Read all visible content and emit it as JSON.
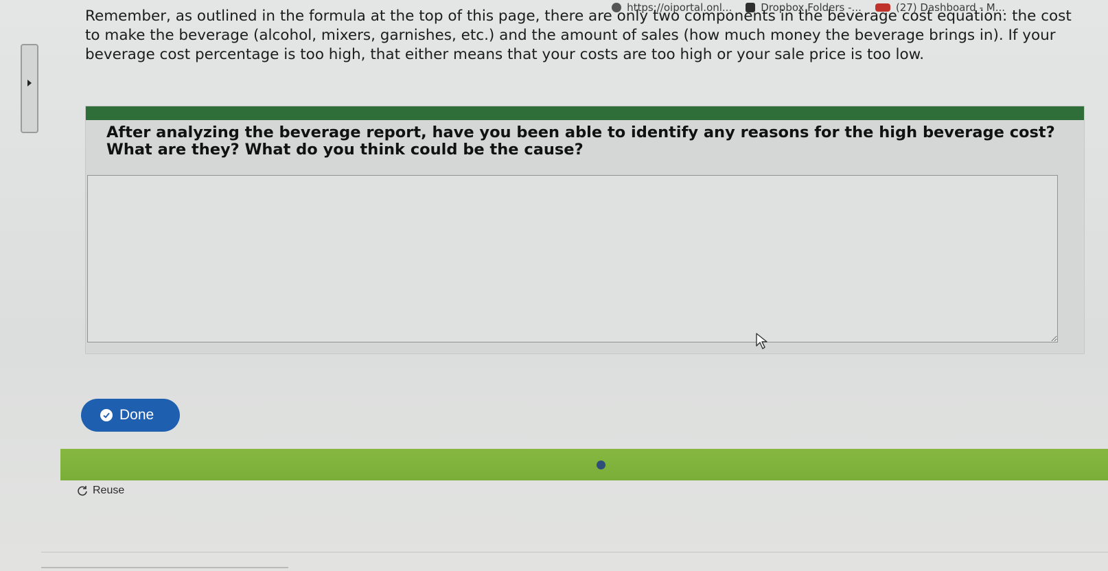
{
  "bookmarks": [
    {
      "label": "https://oiportal.onl...",
      "icon": "globe-icon"
    },
    {
      "label": "Dropbox Folders -...",
      "icon": "dropbox-icon"
    },
    {
      "label": "(27) Dashboard - M...",
      "icon": "dashboard-icon"
    }
  ],
  "intro": {
    "text": "Remember, as outlined in the formula at the top of this page, there are only two components in the beverage cost equation: the cost to make the beverage (alcohol, mixers, garnishes, etc.) and the amount of sales (how much money the beverage brings in). If your beverage cost percentage is too high, that either means that your costs are too high or your sale price is too low."
  },
  "question": {
    "text": "After analyzing the beverage report, have you been able to identify any reasons for the high beverage cost? What are they? What do you think could be the cause?",
    "answer": ""
  },
  "done_button": {
    "label": "Done"
  },
  "reuse": {
    "label": "Reuse"
  },
  "colors": {
    "header_bar": "#2f6e38",
    "done_button": "#1f5fb0",
    "progress_strip": "#7aae38",
    "progress_dot": "#2f4f7a"
  }
}
